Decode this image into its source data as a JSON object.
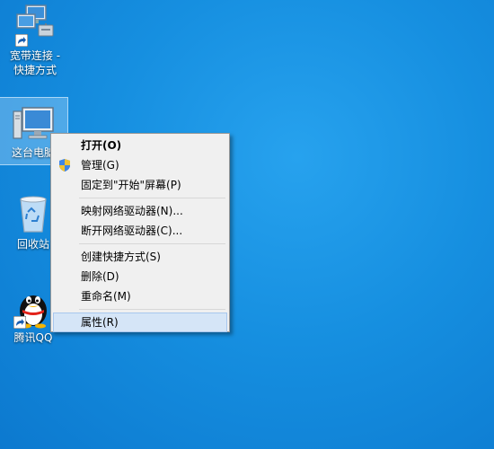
{
  "desktop": {
    "icons": [
      {
        "id": "broadband",
        "label_line1": "宽带连接 -",
        "label_line2": "快捷方式"
      },
      {
        "id": "this-pc",
        "label": "这台电脑"
      },
      {
        "id": "recycle-bin",
        "label": "回收站"
      },
      {
        "id": "qq",
        "label": "腾讯QQ"
      }
    ]
  },
  "context_menu": {
    "items": [
      {
        "label": "打开(O)",
        "bold": true
      },
      {
        "label": "管理(G)",
        "icon": "uac-shield-icon"
      },
      {
        "label": "固定到\"开始\"屏幕(P)"
      },
      {
        "separator": true
      },
      {
        "label": "映射网络驱动器(N)..."
      },
      {
        "label": "断开网络驱动器(C)..."
      },
      {
        "separator": true
      },
      {
        "label": "创建快捷方式(S)"
      },
      {
        "label": "删除(D)"
      },
      {
        "label": "重命名(M)"
      },
      {
        "separator": true
      },
      {
        "label": "属性(R)",
        "highlighted": true
      }
    ]
  },
  "colors": {
    "desktop_background": "#168fe0",
    "menu_background": "#f0f0f0",
    "menu_highlight": "#d5e5f7"
  }
}
